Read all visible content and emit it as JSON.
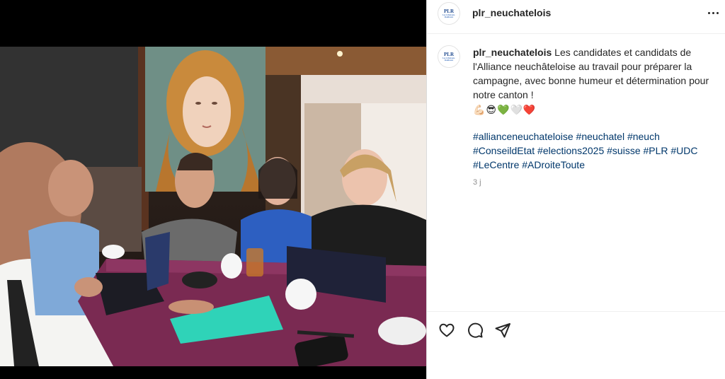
{
  "post": {
    "username": "plr_neuchatelois",
    "avatar_logo": "PLR",
    "avatar_subtext": "Les Libéraux-Radicaux",
    "caption_text": "Les candidates et candidats de l'Alliance neuchâteloise au travail pour préparer la campagne, avec bonne humeur et détermination pour notre canton !",
    "emojis": "💪🏻😎💚🤍❤️",
    "hashtags_line1": "#allianceneuchateloise #neuchatel #neuch",
    "hashtags_line2": "#ConseildEtat #elections2025 #suisse #PLR #UDC",
    "hashtags_line3": "#LeCentre #ADroiteToute",
    "timestamp": "3 j"
  },
  "icons": {
    "more": "more-options-icon",
    "like": "heart-icon",
    "comment": "comment-icon",
    "share": "paper-plane-icon"
  },
  "colors": {
    "hashtag": "#00376b",
    "text": "#262626",
    "muted": "#8e8e8e",
    "border": "#efefef",
    "table": "#7a2a52",
    "folder": "#2fd3b8"
  }
}
